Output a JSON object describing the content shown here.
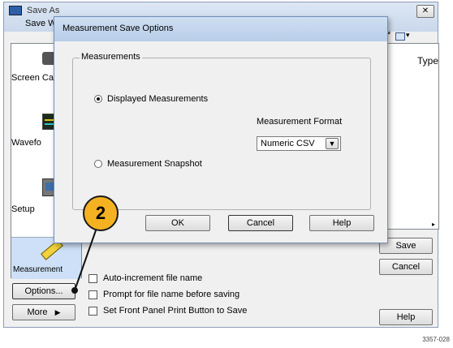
{
  "outer": {
    "title": "Save As",
    "save_in_label": "Save W",
    "close_glyph": "✕",
    "column_type": "Type",
    "left_items": [
      "Screen Ca",
      "Wavefo",
      "Setup",
      "Measurement"
    ],
    "options_label": "Options...",
    "more_label": "More",
    "save_label": "Save",
    "cancel_label": "Cancel",
    "help_label": "Help",
    "checkboxes": [
      "Auto-increment file name",
      "Prompt for file name before saving",
      "Set Front Panel Print Button to Save"
    ],
    "view_glyph": "▾"
  },
  "dialog": {
    "title": "Measurement Save Options",
    "group_label": "Measurements",
    "radio_displayed": "Displayed Measurements",
    "radio_snapshot": "Measurement Snapshot",
    "format_label": "Measurement Format",
    "format_value": "Numeric CSV",
    "ok_label": "OK",
    "cancel_label": "Cancel",
    "help_label": "Help"
  },
  "callout": "2",
  "figure_number": "3357-028",
  "colors": {
    "callout": "#f4b223",
    "title_bar": "#c9d8eb"
  }
}
